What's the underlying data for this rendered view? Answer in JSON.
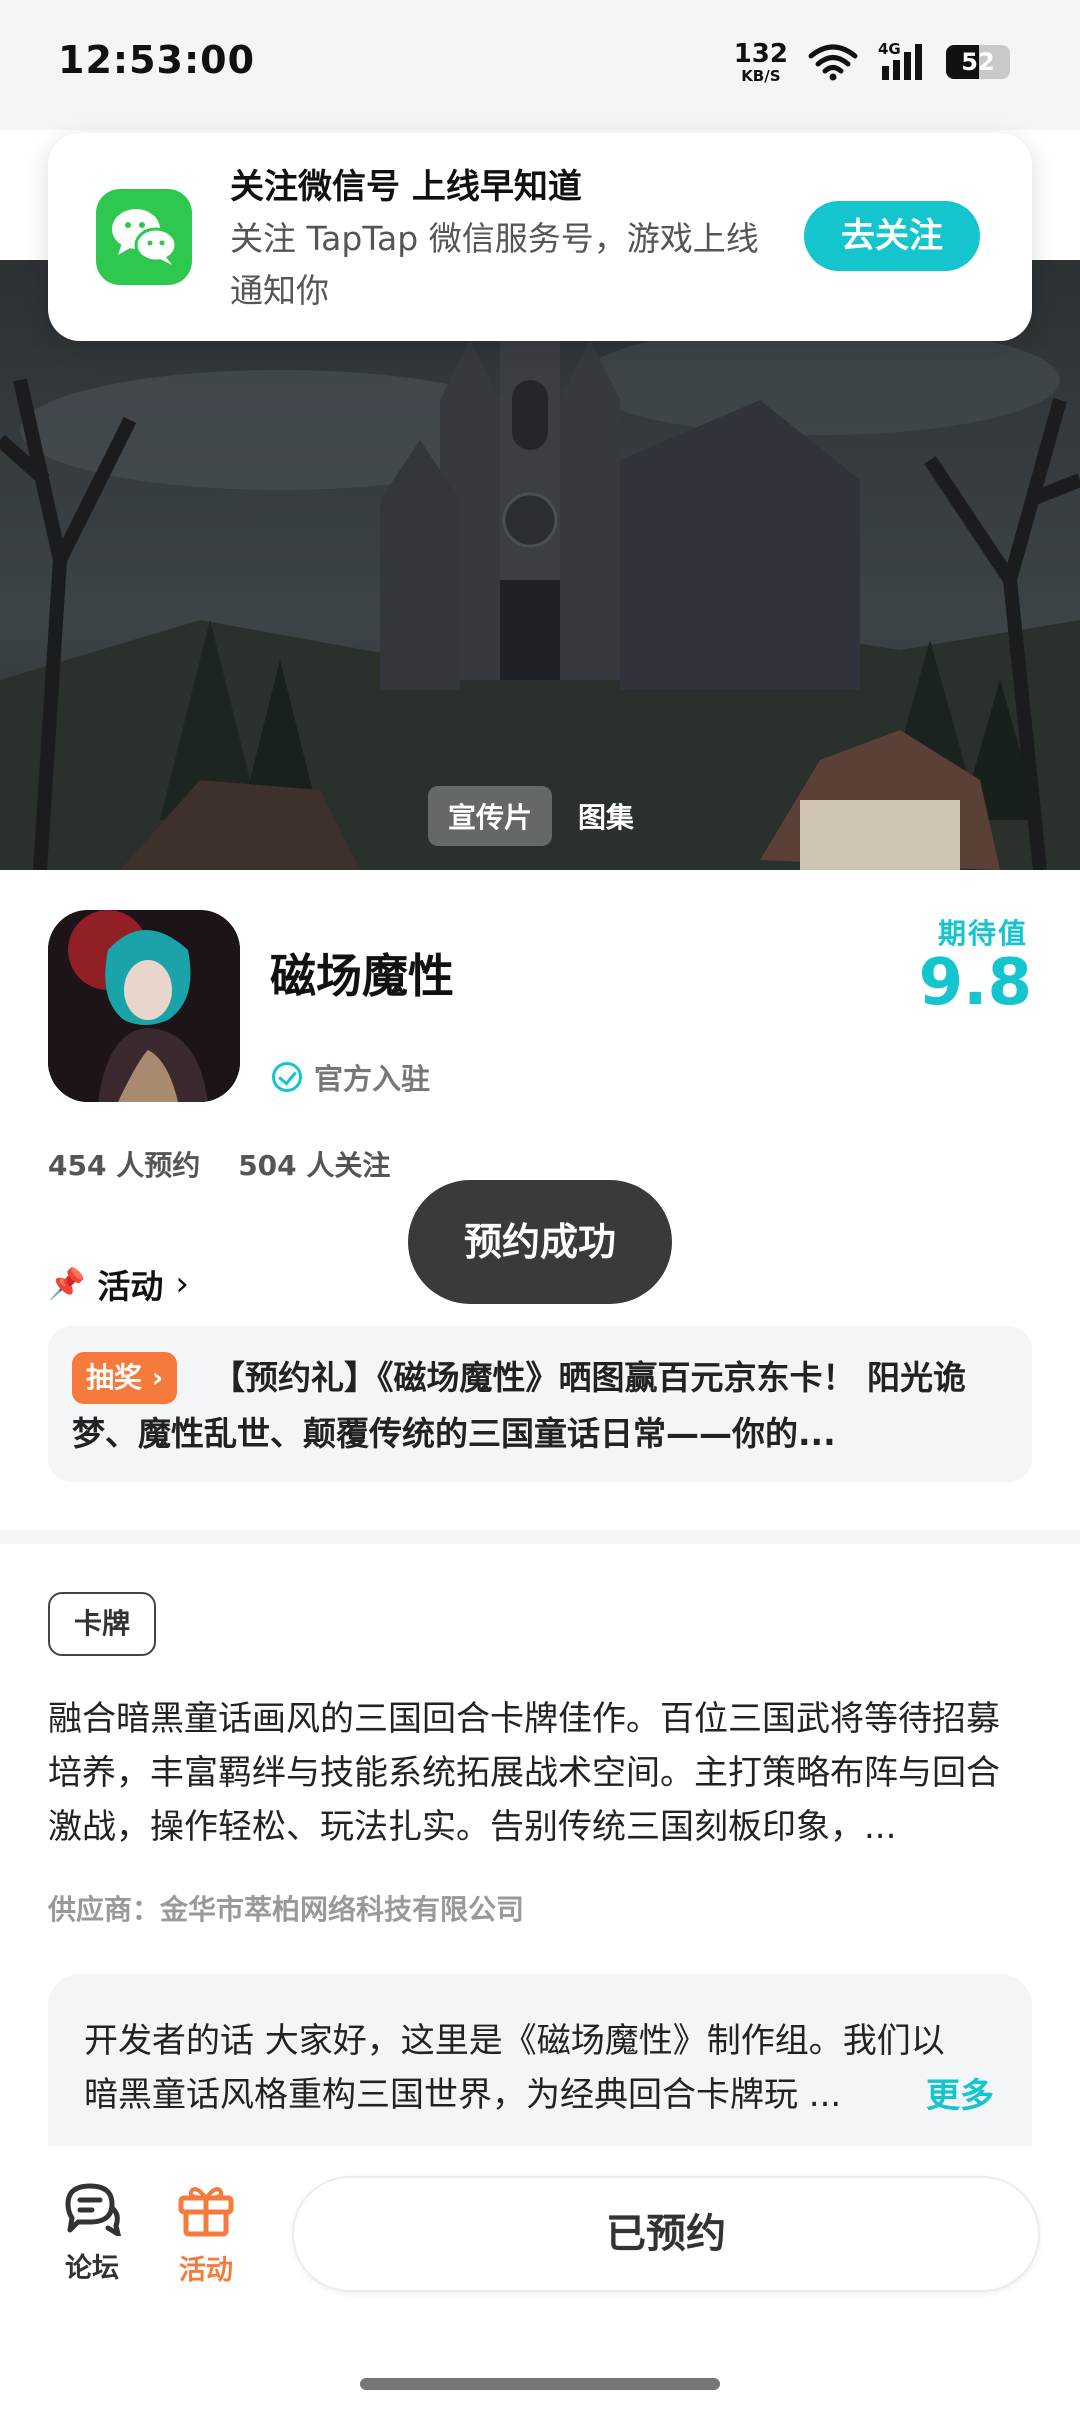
{
  "status_bar": {
    "time": "12:53:00",
    "net_speed": "132",
    "net_unit": "KB/S",
    "network": "4G",
    "battery": "52",
    "icons": [
      "wifi-icon",
      "signal-icon",
      "battery-icon"
    ]
  },
  "follow_card": {
    "title": "关注微信号 上线早知道",
    "description": "关注 TapTap 微信服务号，游戏上线通知你",
    "button": "去关注",
    "icon": "wechat-icon"
  },
  "media": {
    "tabs": [
      {
        "label": "宣传片",
        "active": true
      },
      {
        "label": "图集",
        "active": false
      }
    ]
  },
  "game": {
    "title": "磁场魔性",
    "official_label": "官方入驻",
    "expect_label": "期待值",
    "expect_value": "9.8",
    "reservations": "454 人预约",
    "followers": "504 人关注"
  },
  "toast": "预约成功",
  "activity": {
    "heading": "活动",
    "badge": "抽奖",
    "text": "【预约礼】《磁场魔性》晒图赢百元京东卡！ 阳光诡梦、魔性乱世、颠覆传统的三国童话日常——你的..."
  },
  "details": {
    "tag": "卡牌",
    "description": "融合暗黑童话画风的三国回合卡牌佳作。百位三国武将等待招募培养，丰富羁绊与技能系统拓展战术空间。主打策略布阵与回合激战，操作轻松、玩法扎实。告别传统三国刻板印象，...",
    "supplier": "供应商：金华市萃柏网络科技有限公司"
  },
  "developer_note": {
    "text": "开发者的话  大家好，这里是《磁场魔性》制作组。我们以暗黑童话风格重构三国世界，为经典回合卡牌玩 ...",
    "more": "更多"
  },
  "bottom_bar": {
    "forum": "论坛",
    "activity": "活动",
    "reserved": "已预约"
  },
  "colors": {
    "accent": "#15c5ce",
    "orange": "#f57a3c",
    "wechat_green": "#2dc84d"
  }
}
